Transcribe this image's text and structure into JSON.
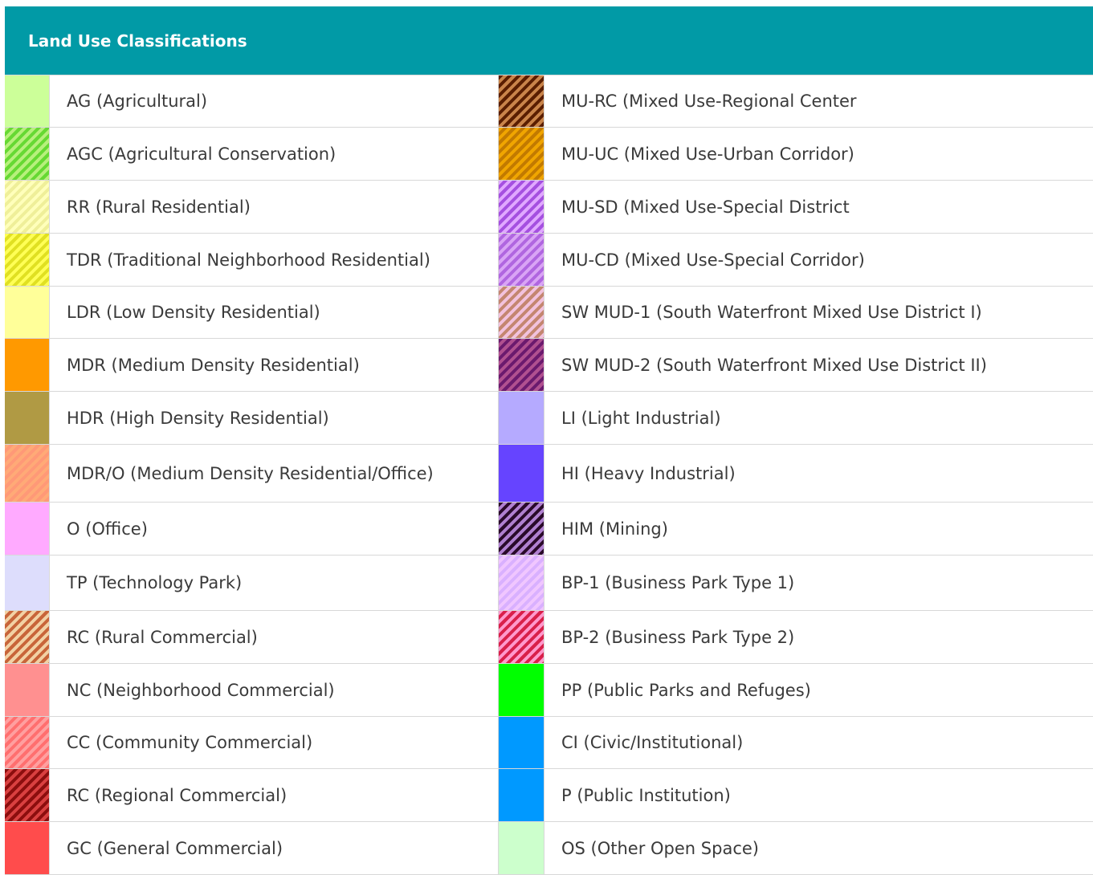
{
  "header": {
    "title": "Land Use Classifications"
  },
  "rows": [
    {
      "height": 65,
      "left": {
        "label": "AG (Agricultural)",
        "fill": "#ccff99",
        "stripe": null
      },
      "right": {
        "label": "MU-RC (Mixed Use-Regional Center",
        "fill": "#5a1e00",
        "stripe": "#c9844a"
      }
    },
    {
      "height": 66,
      "left": {
        "label": "AGC (Agricultural Conservation)",
        "fill": "#b7f07c",
        "stripe": "#66d933"
      },
      "right": {
        "label": "MU-UC (Mixed Use-Urban Corridor)",
        "fill": "#f0a500",
        "stripe": "#c27a00"
      }
    },
    {
      "height": 66,
      "left": {
        "label": "RR (Rural Residential)",
        "fill": "#ffffbb",
        "stripe": "#efef99"
      },
      "right": {
        "label": "MU-SD (Mixed Use-Special District",
        "fill": "#e0a8ff",
        "stripe": "#a550e0"
      }
    },
    {
      "height": 66,
      "left": {
        "label": "TDR (Traditional Neighborhood Residential)",
        "fill": "#ffff55",
        "stripe": "#e0e022"
      },
      "right": {
        "label": "MU-CD (Mixed Use-Special Corridor)",
        "fill": "#d9a4f5",
        "stripe": "#b066e0"
      }
    },
    {
      "height": 65,
      "left": {
        "label": "LDR (Low Density Residential)",
        "fill": "#ffff99",
        "stripe": null
      },
      "right": {
        "label": "SW MUD-1 (South Waterfront Mixed Use District I)",
        "fill": "#f2c2dd",
        "stripe": "#c48670"
      }
    },
    {
      "height": 66,
      "left": {
        "label": "MDR (Medium Density Residential)",
        "fill": "#ff9900",
        "stripe": null
      },
      "right": {
        "label": "SW MUD-2 (South Waterfront Mixed Use District II)",
        "fill": "#6b1a6e",
        "stripe": "#b05090"
      }
    },
    {
      "height": 66,
      "left": {
        "label": "HDR (High Density Residential)",
        "fill": "#b09a44",
        "stripe": null
      },
      "right": {
        "label": "LI (Light Industrial)",
        "fill": "#b5aaff",
        "stripe": null
      }
    },
    {
      "height": 72,
      "left": {
        "label": "MDR/O (Medium Density Residential/Office)",
        "fill": "#ffaa77",
        "stripe": "#ff9977"
      },
      "right": {
        "label": "HI (Heavy Industrial)",
        "fill": "#6644ff",
        "stripe": null
      }
    },
    {
      "height": 66,
      "left": {
        "label": "O (Office)",
        "fill": "#ffaaff",
        "stripe": null
      },
      "right": {
        "label": "HIM (Mining)",
        "fill": "#2a0a2a",
        "stripe": "#b080d0"
      }
    },
    {
      "height": 69,
      "left": {
        "label": "TP (Technology Park)",
        "fill": "#ddddfc",
        "stripe": null
      },
      "right": {
        "label": "BP-1 (Business Park Type 1)",
        "fill": "#d9b0ff",
        "stripe": "#f0c6ff"
      }
    },
    {
      "height": 66,
      "left": {
        "label": "RC (Rural Commercial)",
        "fill": "#f2d1a4",
        "stripe": "#c8653a"
      },
      "right": {
        "label": "BP-2 (Business Park Type 2)",
        "fill": "#ff99cc",
        "stripe": "#d9204a"
      }
    },
    {
      "height": 66,
      "left": {
        "label": "NC (Neighborhood Commercial)",
        "fill": "#ff9090",
        "stripe": null
      },
      "right": {
        "label": "PP (Public Parks and Refuges)",
        "fill": "#00ff00",
        "stripe": null
      }
    },
    {
      "height": 65,
      "left": {
        "label": "CC (Community Commercial)",
        "fill": "#ff6f6f",
        "stripe": "#ff9f9f"
      },
      "right": {
        "label": "CI (Civic/Institutional)",
        "fill": "#0099ff",
        "stripe": null
      }
    },
    {
      "height": 66,
      "left": {
        "label": "RC (Regional Commercial)",
        "fill": "#8c0e0e",
        "stripe": "#d94040"
      },
      "right": {
        "label": "P (Public Institution)",
        "fill": "#0099ff",
        "stripe": null
      }
    },
    {
      "height": 66,
      "left": {
        "label": "GC (General Commercial)",
        "fill": "#ff4c4c",
        "stripe": null
      },
      "right": {
        "label": "OS (Other Open Space)",
        "fill": "#ccffcc",
        "stripe": null
      }
    }
  ]
}
